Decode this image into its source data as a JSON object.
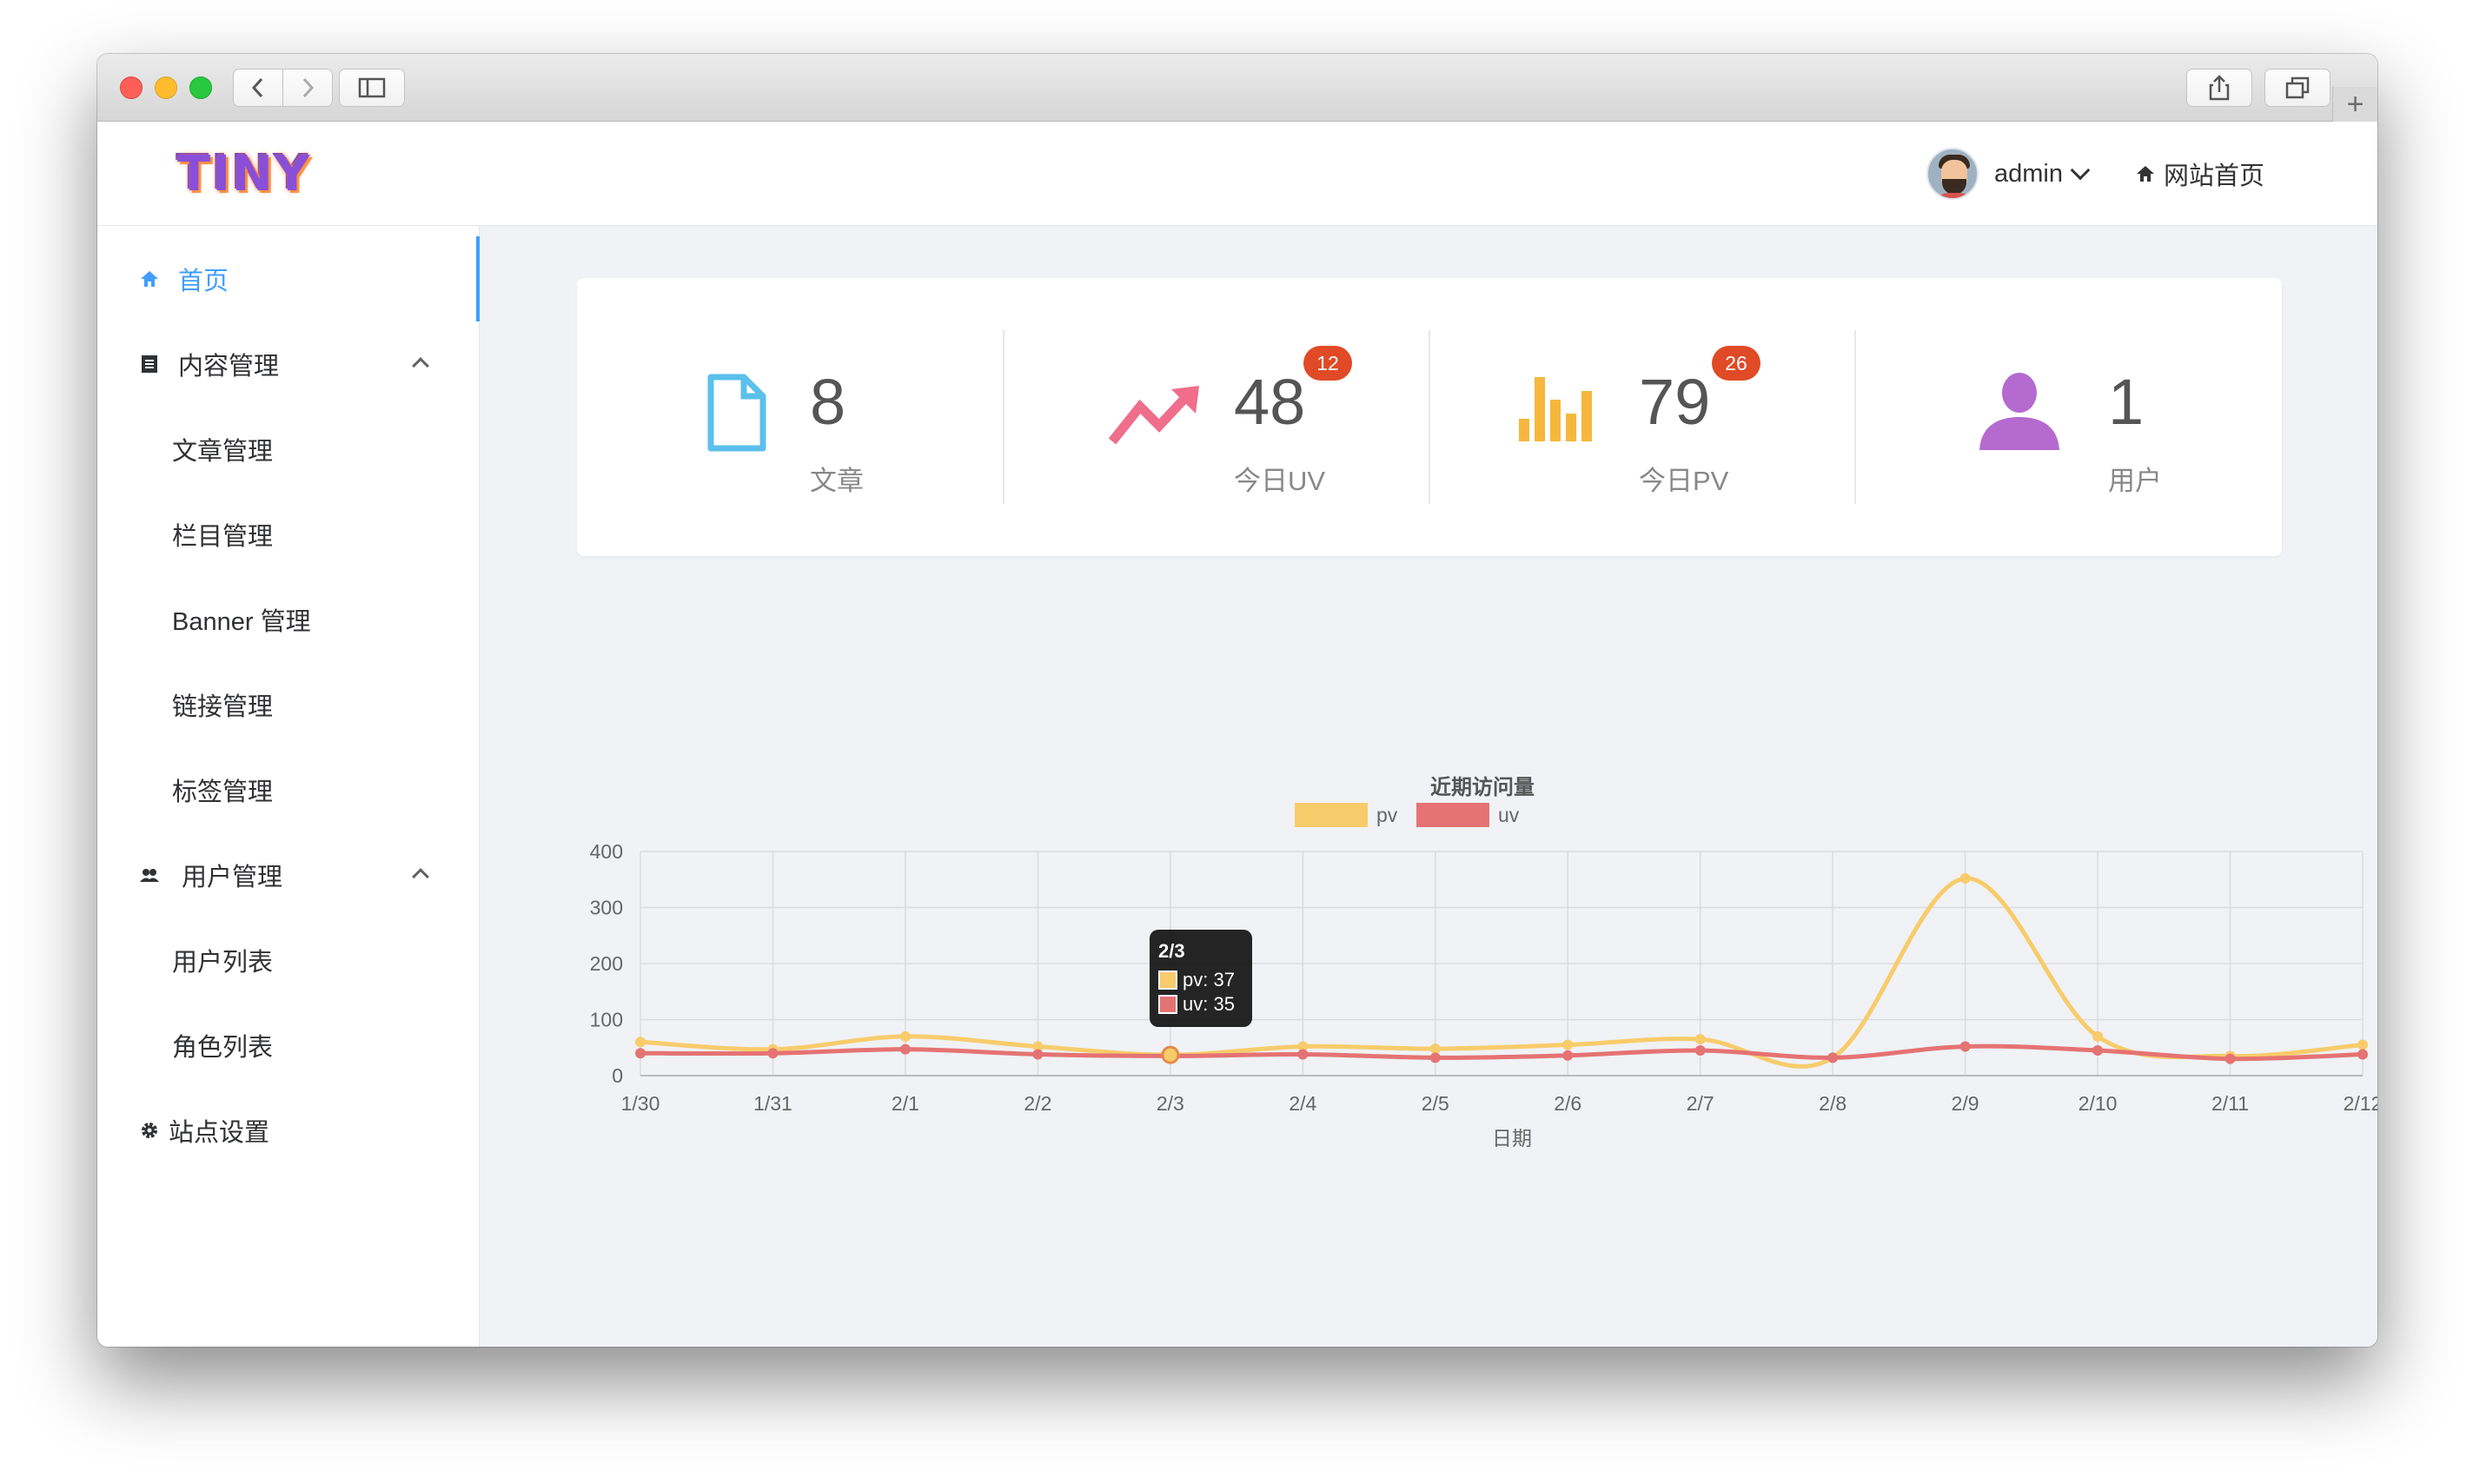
{
  "app": {
    "logo_text": "TINY"
  },
  "header": {
    "username": "admin",
    "home_link": "网站首页"
  },
  "sidebar": {
    "items": [
      {
        "label": "首页",
        "icon": "home-icon",
        "active": true
      },
      {
        "label": "内容管理",
        "icon": "content-icon",
        "expanded": true
      },
      {
        "label": "文章管理"
      },
      {
        "label": "栏目管理"
      },
      {
        "label": "Banner 管理"
      },
      {
        "label": "链接管理"
      },
      {
        "label": "标签管理"
      },
      {
        "label": "用户管理",
        "icon": "users-icon",
        "expanded": true
      },
      {
        "label": "用户列表"
      },
      {
        "label": "角色列表"
      },
      {
        "label": "站点设置",
        "icon": "gear-icon"
      }
    ]
  },
  "stats": [
    {
      "value": "8",
      "label": "文章",
      "icon": "document-icon",
      "color": "#5bc0eb"
    },
    {
      "value": "48",
      "label": "今日UV",
      "badge": "12",
      "icon": "trend-up-icon",
      "color": "#f06d8b"
    },
    {
      "value": "79",
      "label": "今日PV",
      "badge": "26",
      "icon": "bar-chart-icon",
      "color": "#f6b73c"
    },
    {
      "value": "1",
      "label": "用户",
      "icon": "user-icon",
      "color": "#b46acf"
    }
  ],
  "chart_data": {
    "type": "line",
    "title": "近期访问量",
    "xlabel": "日期",
    "ylabel": "",
    "categories": [
      "1/30",
      "1/31",
      "2/1",
      "2/2",
      "2/3",
      "2/4",
      "2/5",
      "2/6",
      "2/7",
      "2/8",
      "2/9",
      "2/10",
      "2/11",
      "2/12"
    ],
    "ylim": [
      0,
      400
    ],
    "yticks": [
      "0",
      "100",
      "200",
      "300",
      "400"
    ],
    "series": [
      {
        "name": "pv",
        "color": "#f8cc6b",
        "values": [
          60,
          47,
          70,
          52,
          37,
          52,
          48,
          55,
          65,
          32,
          352,
          70,
          35,
          55
        ]
      },
      {
        "name": "uv",
        "color": "#e57373",
        "values": [
          40,
          40,
          47,
          38,
          35,
          38,
          32,
          36,
          45,
          32,
          52,
          45,
          30,
          38
        ]
      }
    ],
    "legend": "top",
    "grid": true,
    "tooltip": {
      "title": "2/3",
      "rows": [
        "pv: 37",
        "uv: 35"
      ]
    }
  }
}
